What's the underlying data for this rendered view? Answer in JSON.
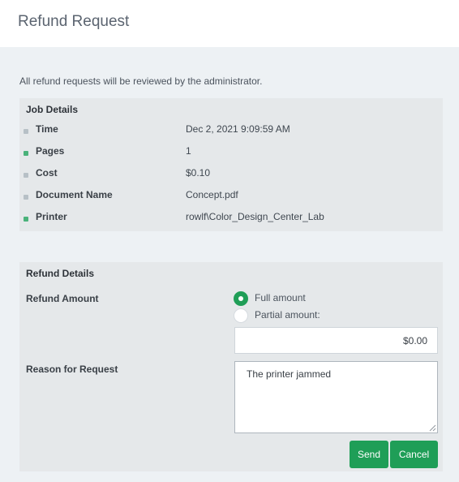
{
  "header": {
    "title": "Refund Request"
  },
  "intro_text": "All refund requests will be reviewed by the administrator.",
  "job_details": {
    "title": "Job Details",
    "rows": [
      {
        "label": "Time",
        "value": "Dec 2, 2021 9:09:59 AM",
        "icon": "clock-icon"
      },
      {
        "label": "Pages",
        "value": "1",
        "icon": "pages-icon"
      },
      {
        "label": "Cost",
        "value": "$0.10",
        "icon": "cost-icon"
      },
      {
        "label": "Document Name",
        "value": "Concept.pdf",
        "icon": "document-icon"
      },
      {
        "label": "Printer",
        "value": "rowlf\\Color_Design_Center_Lab",
        "icon": "printer-icon"
      }
    ]
  },
  "refund_details": {
    "title": "Refund Details",
    "amount_label": "Refund Amount",
    "full_amount_label": "Full amount",
    "partial_amount_label": "Partial amount:",
    "selected_option": "full",
    "partial_amount_value": "$0.00",
    "reason_label": "Reason for Request",
    "reason_value": "The printer jammed"
  },
  "buttons": {
    "send_label": "Send",
    "cancel_label": "Cancel"
  },
  "colors": {
    "accent": "#1f9e57",
    "page_background": "#edf1f4",
    "panel_background": "#e5e8ea"
  }
}
